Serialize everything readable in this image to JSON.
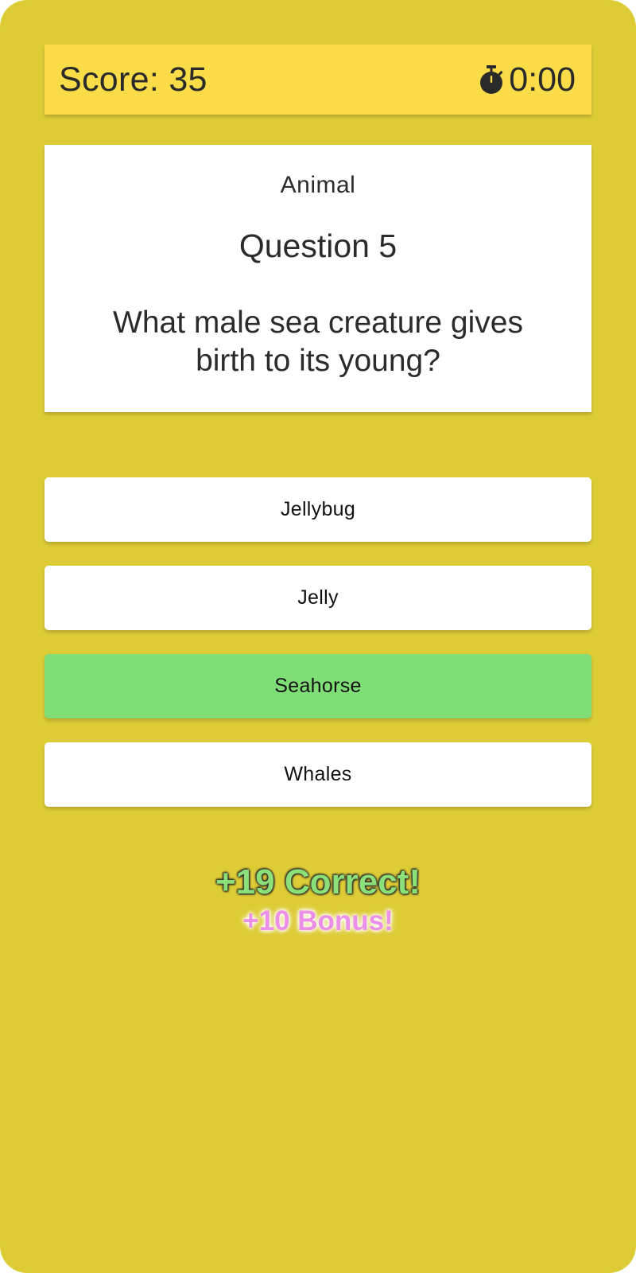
{
  "header": {
    "score_text": "Score: 35",
    "timer_text": "0:00",
    "timer_icon": "stopwatch-icon",
    "background_color": "#f9dc47"
  },
  "question": {
    "category": "Animal",
    "number_label": "Question 5",
    "text": "What male sea creature gives birth to its young?"
  },
  "answers": [
    {
      "label": "Jellybug",
      "state": "default"
    },
    {
      "label": "Jelly",
      "state": "default"
    },
    {
      "label": "Seahorse",
      "state": "correct"
    },
    {
      "label": "Whales",
      "state": "default"
    }
  ],
  "feedback": {
    "correct": "+19 Correct!",
    "bonus": "+10 Bonus!"
  },
  "colors": {
    "app_background": "#decc36",
    "correct_answer": "#7fde75",
    "correct_text": "#8ce07a",
    "bonus_text": "#ec8fe9"
  }
}
